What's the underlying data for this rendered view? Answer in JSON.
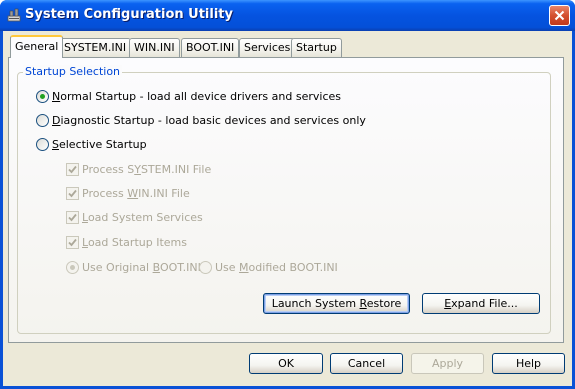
{
  "window": {
    "title": "System Configuration Utility",
    "icon": "config-utility-icon"
  },
  "tabs": [
    {
      "label": "General",
      "active": true
    },
    {
      "label": "SYSTEM.INI",
      "active": false
    },
    {
      "label": "WIN.INI",
      "active": false
    },
    {
      "label": "BOOT.INI",
      "active": false
    },
    {
      "label": "Services",
      "active": false
    },
    {
      "label": "Startup",
      "active": false
    }
  ],
  "startup_selection": {
    "label": "Startup Selection",
    "normal": {
      "mnemonic": "N",
      "rest": "ormal Startup - load all device drivers and services",
      "selected": true
    },
    "diagnostic": {
      "mnemonic": "D",
      "rest": "iagnostic Startup - load basic devices and services only",
      "selected": false
    },
    "selective": {
      "mnemonic": "S",
      "rest": "elective Startup",
      "selected": false
    },
    "options": {
      "system_ini": {
        "pre": "Process S",
        "mnemonic": "Y",
        "rest": "STEM.INI File",
        "checked": true
      },
      "win_ini": {
        "pre": "Process ",
        "mnemonic": "W",
        "rest": "IN.INI File",
        "checked": true
      },
      "services": {
        "pre": "",
        "mnemonic": "L",
        "rest": "oad System Services",
        "checked": true
      },
      "startup_items": {
        "pre": "",
        "mnemonic": "L",
        "rest": "oad Startup Items",
        "checked": true
      },
      "original_boot": {
        "pre": "Use Original ",
        "mnemonic": "B",
        "rest": "OOT.INI",
        "selected": true
      },
      "modified_boot": {
        "pre": "Use ",
        "mnemonic": "M",
        "rest": "odified BOOT.INI",
        "selected": false
      }
    }
  },
  "panel_buttons": {
    "launch_restore": {
      "pre": "Launch System ",
      "mnemonic": "R",
      "rest": "estore"
    },
    "expand_file": {
      "pre": "",
      "mnemonic": "E",
      "rest": "xpand File..."
    }
  },
  "dialog_buttons": {
    "ok": "OK",
    "cancel": "Cancel",
    "apply": "Apply",
    "help": "Help"
  },
  "colors": {
    "titlebar": "#0553e0",
    "group_label": "#0046d5",
    "radio_selected": "#21a121",
    "active_tab_highlight": "#ffc83c"
  }
}
